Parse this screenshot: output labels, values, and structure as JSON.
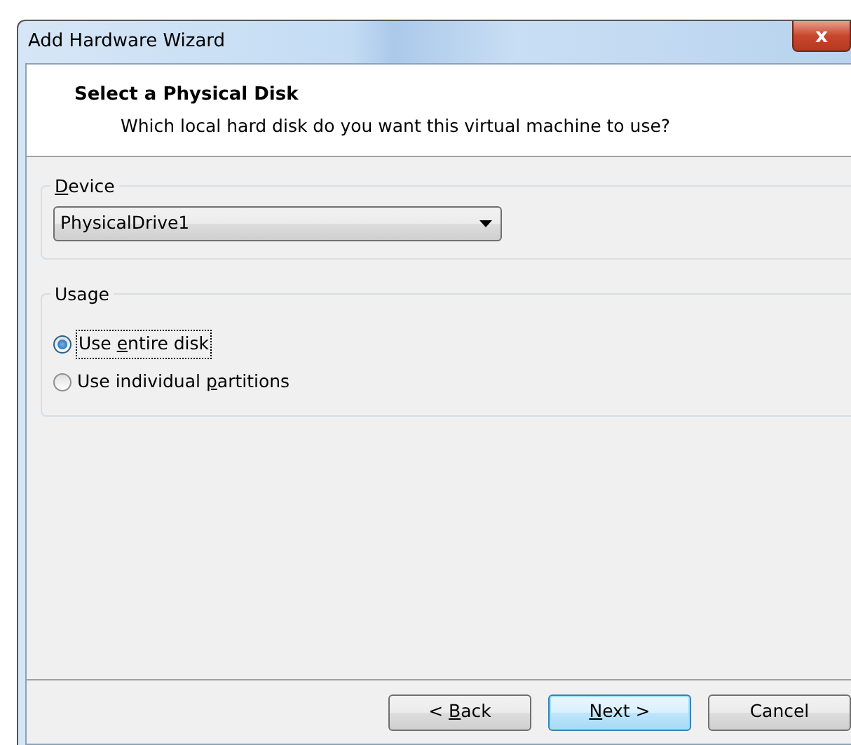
{
  "window": {
    "title": "Add Hardware Wizard",
    "close_glyph": "x"
  },
  "header": {
    "title": "Select a Physical Disk",
    "subtitle": "Which local hard disk do you want this virtual machine to use?"
  },
  "device_group": {
    "label": {
      "key": "D",
      "after": "evice"
    },
    "dropdown": {
      "value": "PhysicalDrive1"
    }
  },
  "usage_group": {
    "label": {
      "after": "Usage"
    },
    "options": [
      {
        "label": {
          "before": "Use ",
          "key": "e",
          "after": "ntire disk"
        },
        "selected": true,
        "focused": true
      },
      {
        "label": {
          "before": "Use individual ",
          "key": "p",
          "after": "artitions"
        },
        "selected": false,
        "focused": false
      }
    ]
  },
  "buttons": [
    {
      "label": {
        "before": "< ",
        "key": "B",
        "after": "ack"
      },
      "default": false
    },
    {
      "label": {
        "key": "N",
        "after": "ext >"
      },
      "default": true
    },
    {
      "label": {
        "after": "Cancel"
      },
      "default": false
    }
  ]
}
